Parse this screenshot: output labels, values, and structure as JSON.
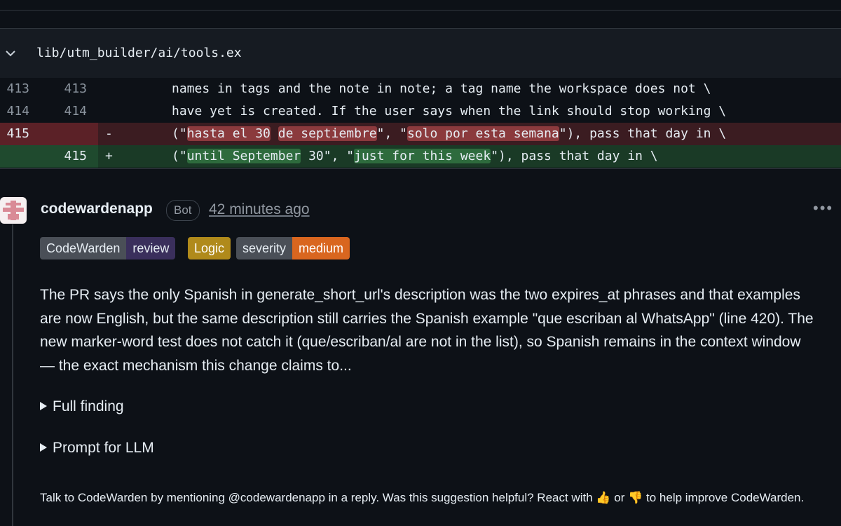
{
  "file": {
    "path": "lib/utm_builder/ai/tools.ex"
  },
  "diff": {
    "lines": [
      {
        "old": "413",
        "new": "413",
        "sign": "",
        "text": "names in tags and the note in note; a tag name the workspace does not \\"
      },
      {
        "old": "414",
        "new": "414",
        "sign": "",
        "text": "have yet is created. If the user says when the link should stop working \\"
      },
      {
        "old": "415",
        "new": "",
        "sign": "-",
        "pre": "(\"",
        "h1": "hasta el 30",
        "mid1": " ",
        "h2": "de septiembre",
        "mid2": "\", \"",
        "h3": "solo por esta semana",
        "post": "\"), pass that day in \\"
      },
      {
        "old": "",
        "new": "415",
        "sign": "+",
        "pre": "(\"",
        "h1": "until September",
        "mid1": " 30\", \"",
        "h2": "just for this week",
        "post": "\"), pass that day in \\"
      }
    ]
  },
  "comment": {
    "author": "codewardenapp",
    "bot_label": "Bot",
    "time": "42 minutes ago",
    "badges": {
      "codewarden_left": "CodeWarden",
      "codewarden_right": "review",
      "logic": "Logic",
      "severity_left": "severity",
      "severity_right": "medium"
    },
    "body": "The PR says the only Spanish in generate_short_url's description was the two expires_at phrases and that examples are now English, but the same description still carries the Spanish example \"que escriban al WhatsApp\" (line 420). The new marker-word test does not catch it (que/escriban/al are not in the list), so Spanish remains in the context window — the exact mechanism this change claims to...",
    "full_finding": "Full finding",
    "prompt_for_llm": "Prompt for LLM",
    "footer": "Talk to CodeWarden by mentioning @codewardenapp in a reply. Was this suggestion helpful? React with 👍 or 👎 to help improve CodeWarden."
  },
  "colors": {
    "deleted": "#5b2127",
    "added": "#1f4a2e",
    "severity": "#d9661f",
    "logic": "#b08a1b"
  }
}
